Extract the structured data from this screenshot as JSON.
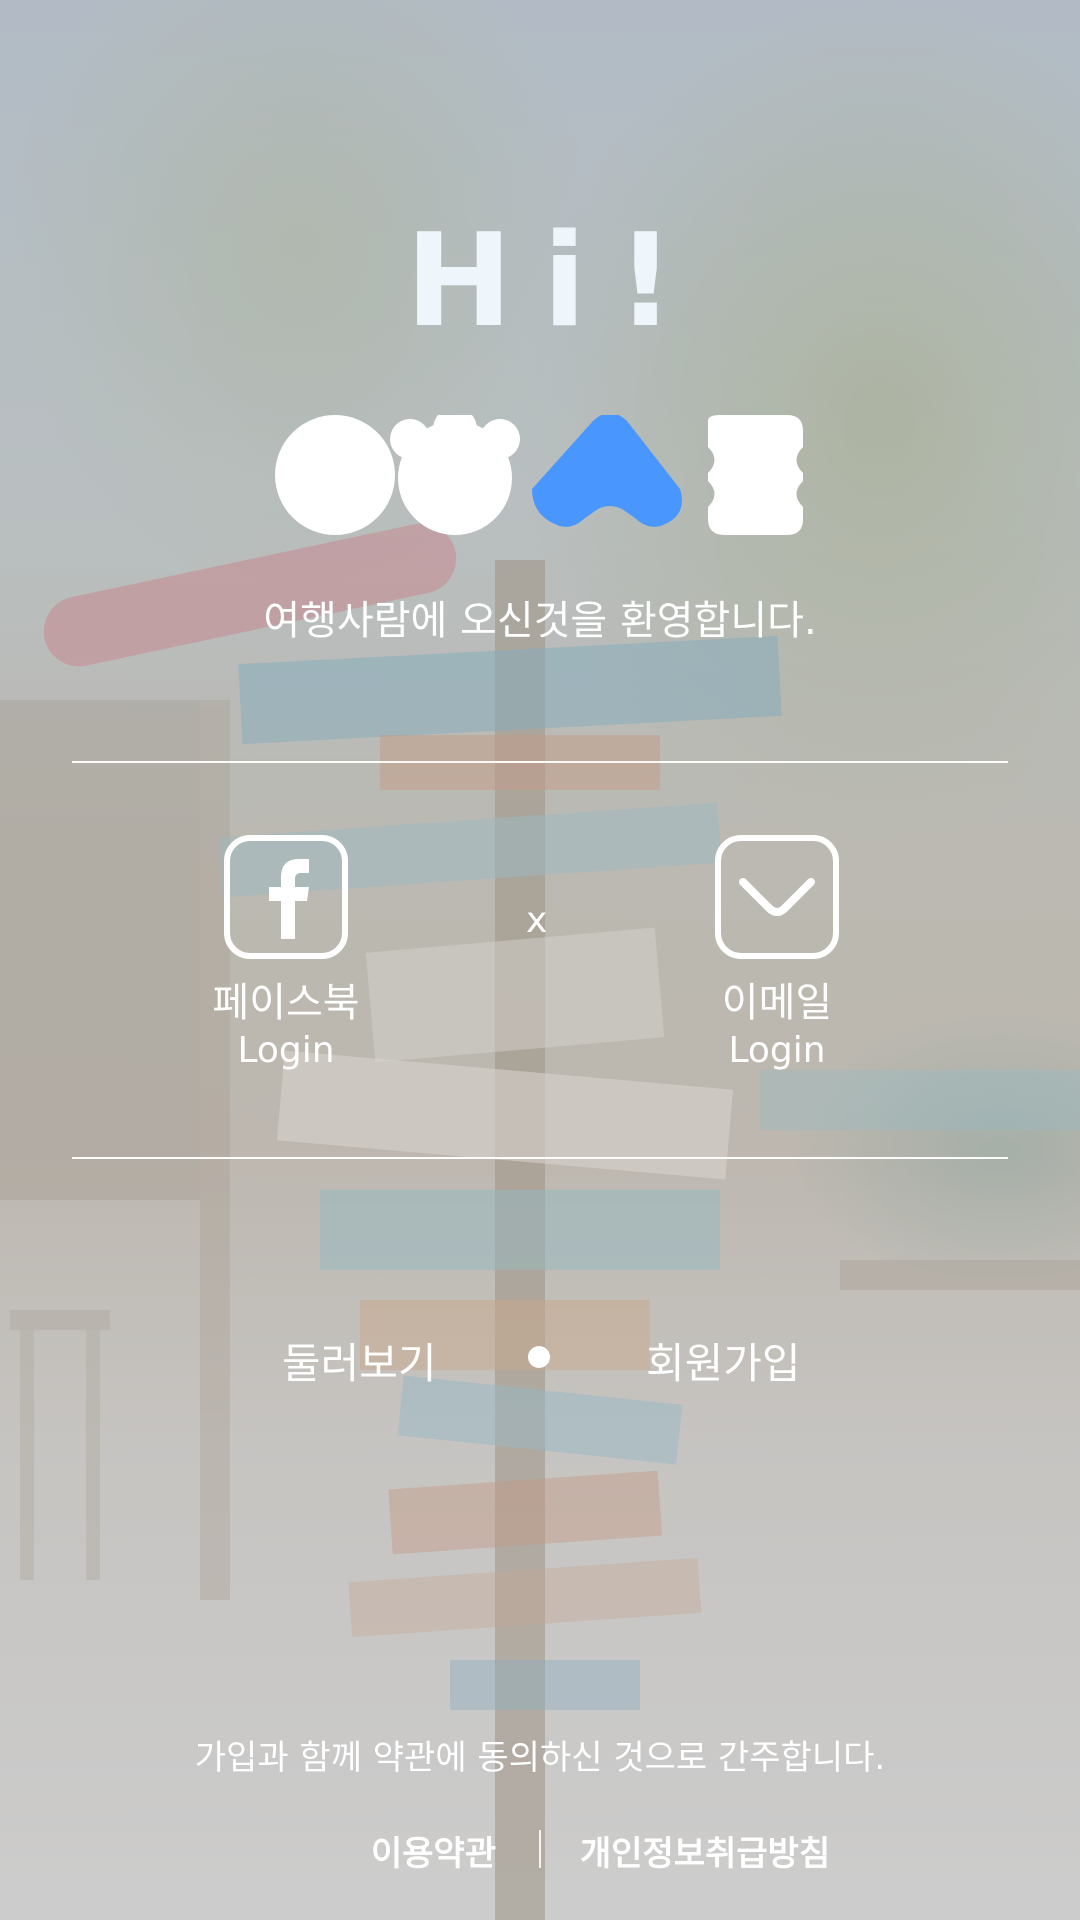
{
  "greeting": "Hi!",
  "welcome_message": "여행사람에 오신것을 환영합니다.",
  "logo": {
    "shapes": [
      "circle",
      "bear",
      "triangle",
      "wave-square"
    ],
    "accent_color": "#4a96ff",
    "base_color": "#ffffff"
  },
  "login": {
    "separator": "x",
    "facebook": {
      "label": "페이스북",
      "sub_label": "Login",
      "icon": "facebook-icon"
    },
    "email": {
      "label": "이메일",
      "sub_label": "Login",
      "icon": "email-icon"
    }
  },
  "nav": {
    "browse": "둘러보기",
    "signup": "회원가입"
  },
  "footer": {
    "notice": "가입과 함께 약관에 동의하신 것으로 간주합니다.",
    "terms": "이용약관",
    "privacy": "개인정보취급방침"
  }
}
